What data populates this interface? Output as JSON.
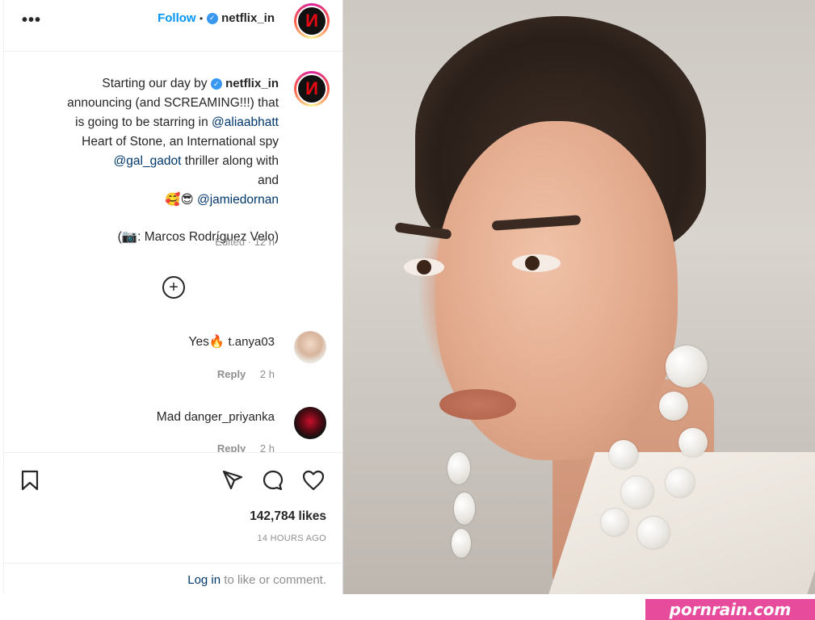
{
  "post": {
    "account": "netflix_in",
    "follow_label": "Follow",
    "separator": "•",
    "more_label": "•••",
    "caption_username": "netflix_in",
    "caption_lines": [
      "Starting our day by",
      "announcing (and SCREAMING!!!) that",
      "is going to be starring in",
      "Heart of Stone, an International spy",
      "thriller along with",
      "and"
    ],
    "mentions": {
      "alia": "@aliaabhatt",
      "gal": "@gal_gadot",
      "jamie": "@jamiedornan"
    },
    "emojis_line": "🥰😎",
    "photo_credit": "(📷: Marcos Rodríguez Velo)",
    "edited_meta": "Edited · 12 h",
    "add_icon": "+",
    "comments": [
      {
        "username": "t.anya03",
        "text": "Yes🔥",
        "meta_time": "2 h",
        "meta_reply": "Reply"
      },
      {
        "username": "danger_priyanka",
        "text": "Mad",
        "meta_time": "2 h",
        "meta_reply": "Reply"
      }
    ],
    "likes": "142,784 likes",
    "time_ago": "14 HOURS AGO",
    "login_link": "Log in",
    "login_text": "to like or comment.",
    "brand_initial": "N"
  },
  "icons": {
    "header_avatar": "netflix-logo",
    "like": "heart-icon",
    "comment": "comment-icon",
    "share": "send-icon",
    "save": "bookmark-icon"
  },
  "colors": {
    "follow_blue": "#0095f6",
    "mention_blue": "#00376b",
    "netflix_red": "#e50914",
    "watermark_pink": "#e74c9c"
  },
  "watermark": "pornrain.com"
}
